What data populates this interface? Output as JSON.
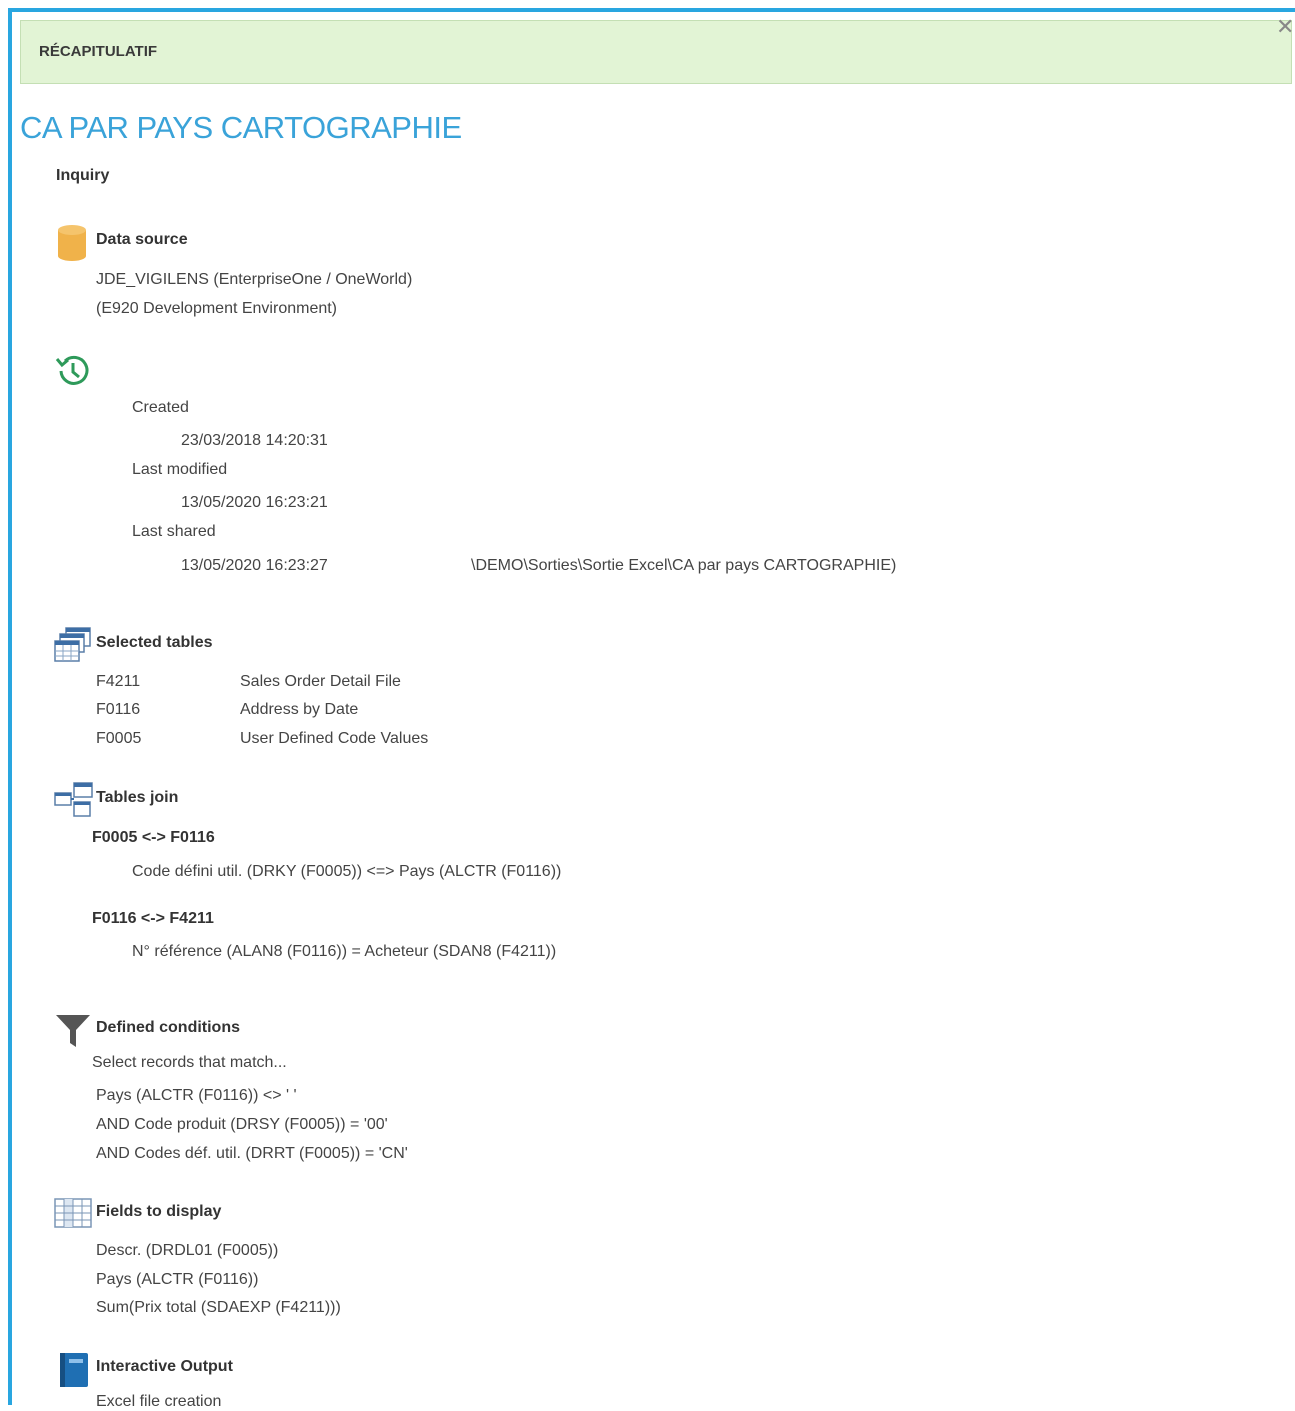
{
  "banner": {
    "title": "RÉCAPITULATIF",
    "close_glyph": "✕"
  },
  "report": {
    "title": "CA PAR PAYS CARTOGRAPHIE",
    "type": "Inquiry"
  },
  "data_source": {
    "heading": "Data source",
    "icon": "database-icon",
    "line1": "JDE_VIGILENS (EnterpriseOne / OneWorld)",
    "line2": "(E920 Development Environment)"
  },
  "history": {
    "icon": "history-icon",
    "created_label": "Created",
    "created_value": "23/03/2018 14:20:31",
    "modified_label": "Last modified",
    "modified_value": "13/05/2020 16:23:21",
    "shared_label": "Last shared",
    "shared_value": "13/05/2020 16:23:27",
    "shared_path": "\\DEMO\\Sorties\\Sortie Excel\\CA par pays CARTOGRAPHIE)"
  },
  "selected_tables": {
    "heading": "Selected tables",
    "icon": "tables-icon",
    "rows": [
      {
        "code": "F4211",
        "desc": "Sales Order Detail File"
      },
      {
        "code": "F0116",
        "desc": "Address by Date"
      },
      {
        "code": "F0005",
        "desc": "User Defined Code Values"
      }
    ]
  },
  "tables_join": {
    "heading": "Tables join",
    "icon": "join-icon",
    "joins": [
      {
        "title": "F0005 <-> F0116",
        "detail": "Code défini util. (DRKY (F0005)) <=> Pays (ALCTR (F0116))"
      },
      {
        "title": "F0116 <-> F4211",
        "detail": "N° référence (ALAN8 (F0116)) = Acheteur (SDAN8 (F4211))"
      }
    ]
  },
  "conditions": {
    "heading": "Defined conditions",
    "icon": "filter-icon",
    "intro": "Select records that match...",
    "lines": [
      "Pays (ALCTR (F0116)) <> ' '",
      "AND Code produit (DRSY (F0005)) = '00'",
      "AND Codes déf. util. (DRRT (F0005)) = 'CN'"
    ]
  },
  "fields": {
    "heading": "Fields to display",
    "icon": "grid-icon",
    "lines": [
      "Descr. (DRDL01 (F0005))",
      "Pays (ALCTR (F0116))",
      "Sum(Prix total (SDAEXP (F4211)))"
    ]
  },
  "output": {
    "heading": "Interactive Output",
    "icon": "notebook-icon",
    "line1": "Excel file creation"
  },
  "colors": {
    "accent": "#3aa3d9",
    "banner_bg": "#e2f4d5",
    "frame": "#29a6e0",
    "history_icon": "#2e9a5a",
    "db_icon": "#f0b24a",
    "notebook": "#1f6fb3"
  }
}
